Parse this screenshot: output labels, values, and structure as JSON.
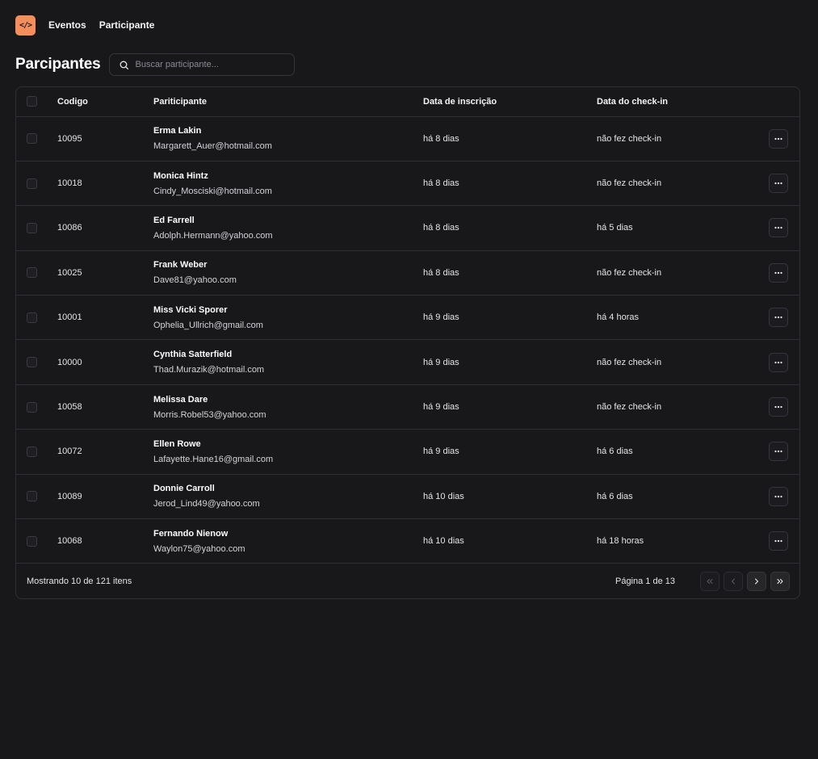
{
  "nav": {
    "logo_text": "</>",
    "items": [
      {
        "label": "Eventos"
      },
      {
        "label": "Participante"
      }
    ]
  },
  "page": {
    "title": "Parcipantes",
    "search_placeholder": "Buscar participante..."
  },
  "table": {
    "headers": {
      "code": "Codigo",
      "participant": "Pariticipante",
      "registered": "Data de inscrição",
      "checkin": "Data do check-in"
    },
    "rows": [
      {
        "code": "10095",
        "name": "Erma Lakin",
        "email": "Margarett_Auer@hotmail.com",
        "registered": "há 8 dias",
        "checkin": "não fez check-in"
      },
      {
        "code": "10018",
        "name": "Monica Hintz",
        "email": "Cindy_Mosciski@hotmail.com",
        "registered": "há 8 dias",
        "checkin": "não fez check-in"
      },
      {
        "code": "10086",
        "name": "Ed Farrell",
        "email": "Adolph.Hermann@yahoo.com",
        "registered": "há 8 dias",
        "checkin": "há 5 dias"
      },
      {
        "code": "10025",
        "name": "Frank Weber",
        "email": "Dave81@yahoo.com",
        "registered": "há 8 dias",
        "checkin": "não fez check-in"
      },
      {
        "code": "10001",
        "name": "Miss Vicki Sporer",
        "email": "Ophelia_Ullrich@gmail.com",
        "registered": "há 9 dias",
        "checkin": "há 4 horas"
      },
      {
        "code": "10000",
        "name": "Cynthia Satterfield",
        "email": "Thad.Murazik@hotmail.com",
        "registered": "há 9 dias",
        "checkin": "não fez check-in"
      },
      {
        "code": "10058",
        "name": "Melissa Dare",
        "email": "Morris.Robel53@yahoo.com",
        "registered": "há 9 dias",
        "checkin": "não fez check-in"
      },
      {
        "code": "10072",
        "name": "Ellen Rowe",
        "email": "Lafayette.Hane16@gmail.com",
        "registered": "há 9 dias",
        "checkin": "há 6 dias"
      },
      {
        "code": "10089",
        "name": "Donnie Carroll",
        "email": "Jerod_Lind49@yahoo.com",
        "registered": "há 10 dias",
        "checkin": "há 6 dias"
      },
      {
        "code": "10068",
        "name": "Fernando Nienow",
        "email": "Waylon75@yahoo.com",
        "registered": "há 10 dias",
        "checkin": "há 18 horas"
      }
    ],
    "row_action_icon": "more-horizontal-icon"
  },
  "footer": {
    "showing": "Mostrando 10 de 121 itens",
    "page_info": "Página 1 de 13"
  },
  "colors": {
    "background": "#18181b",
    "accent": "#f48f5c",
    "border": "#2f2f35"
  }
}
